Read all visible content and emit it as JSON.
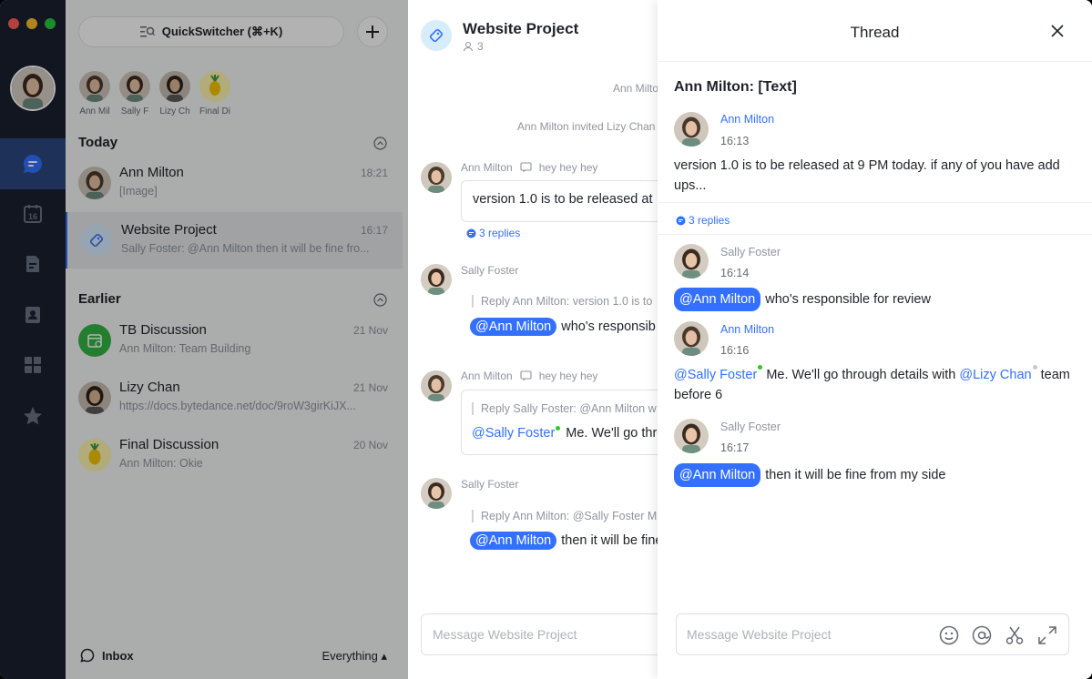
{
  "window": {
    "traffic_lights": [
      "#ff5f57",
      "#febc2e",
      "#28c840"
    ]
  },
  "rail": {
    "items": [
      "chat-icon",
      "calendar-icon",
      "docs-icon",
      "contacts-icon",
      "apps-icon",
      "favorites-icon"
    ],
    "calendar_day": "16",
    "active_color": "#2b4880"
  },
  "list": {
    "quick_switcher": "QuickSwitcher (⌘+K)",
    "recent": [
      {
        "name": "Ann Mil"
      },
      {
        "name": "Sally F"
      },
      {
        "name": "Lizy Ch"
      },
      {
        "name": "Final Di"
      }
    ],
    "today_label": "Today",
    "earlier_label": "Earlier",
    "today": [
      {
        "name": "Ann Milton",
        "preview": "[Image]",
        "time": "18:21"
      },
      {
        "name": "Website Project",
        "preview": "Sally Foster: @Ann Milton then it will be fine fro...",
        "time": "16:17"
      }
    ],
    "earlier": [
      {
        "name": "TB Discussion",
        "preview": "Ann Milton: Team Building",
        "time": "21 Nov"
      },
      {
        "name": "Lizy Chan",
        "preview": "https://docs.bytedance.net/doc/9roW3girKiJX...",
        "time": "21 Nov"
      },
      {
        "name": "Final Discussion",
        "preview": "Ann Milton: Okie",
        "time": "20 Nov"
      }
    ],
    "inbox_label": "Inbox",
    "filter_label": "Everything ▴"
  },
  "chat": {
    "title": "Website Project",
    "members": "3",
    "system_1": "Ann Milto",
    "system_2": "Ann Milton invited Lizy Chan",
    "messages": [
      {
        "sender": "Ann Milton",
        "reply_to": "hey hey hey",
        "text": "version 1.0 is to be released at",
        "replies": "3 replies"
      },
      {
        "sender": "Sally Foster",
        "quote": "Reply Ann Milton: version 1.0 is to",
        "mention": "@Ann Milton",
        "text": "who's responsib"
      },
      {
        "sender": "Ann Milton",
        "reply_to": "hey hey hey",
        "quote": "Reply Sally Foster: @Ann Milton w",
        "mention": "@Sally Foster",
        "text": "Me. We'll go thro"
      },
      {
        "sender": "Sally Foster",
        "quote": "Reply Ann Milton: @Sally Foster M",
        "mention": "@Ann Milton",
        "text": "then it will be fine"
      }
    ],
    "input_placeholder": "Message Website Project"
  },
  "thread": {
    "title": "Thread",
    "heading": "Ann Milton: [Text]",
    "root": {
      "sender": "Ann Milton",
      "time": "16:13",
      "text": "version 1.0 is to be released at 9 PM today. if any of you have add ups...",
      "replies": "3 replies"
    },
    "replies": [
      {
        "sender": "Sally Foster",
        "time": "16:14",
        "mention": "@Ann Milton",
        "text": "who's responsible for review"
      },
      {
        "sender": "Ann Milton",
        "time": "16:16",
        "mention": "@Sally Foster",
        "text_1": "Me. We'll go through details with",
        "mention_2": "@Lizy Chan",
        "text_2": "team before 6"
      },
      {
        "sender": "Sally Foster",
        "time": "16:17",
        "mention": "@Ann Milton",
        "text": "then it will be fine from my side"
      }
    ],
    "input_placeholder": "Message Website Project",
    "input_tools": [
      "emoji-icon",
      "mention-icon",
      "scissors-icon",
      "expand-icon"
    ]
  },
  "colors": {
    "accent": "#3370ff",
    "online": "#34c724"
  }
}
